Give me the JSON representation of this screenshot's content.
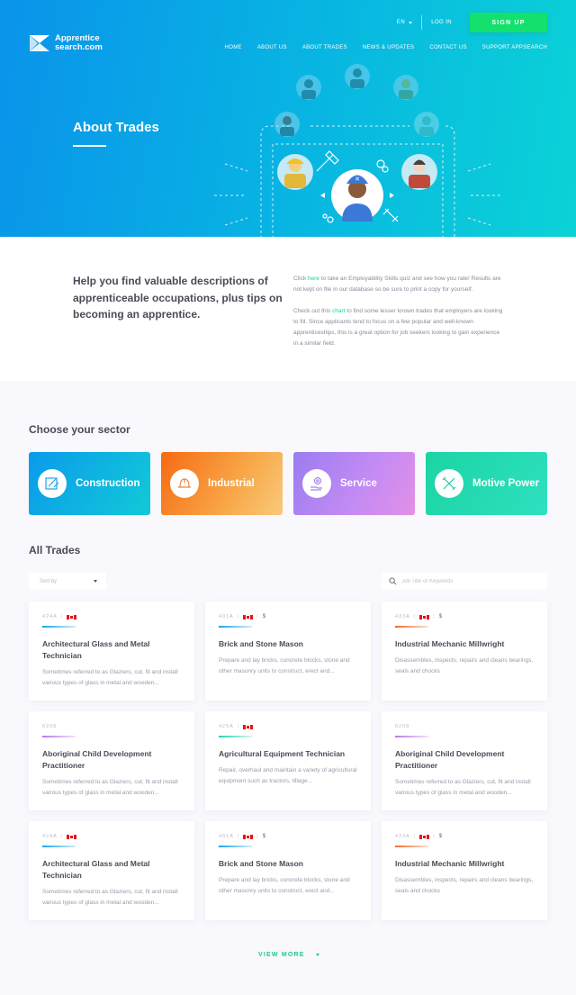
{
  "header": {
    "logo_line1": "Apprentice",
    "logo_line2": "search.com",
    "language": "EN",
    "login_label": "LOG IN",
    "signup_label": "SIGN UP",
    "nav": [
      "HOME",
      "ABOUT US",
      "ABOUT TRADES",
      "NEWS & UPDATES",
      "CONTACT US",
      "SUPPORT APPSEARCH"
    ]
  },
  "hero": {
    "title": "About Trades"
  },
  "intro": {
    "lead": "Help you find valuable descriptions of apprenticeable occupations, plus tips on becoming an apprentice.",
    "p1_before": "Click ",
    "p1_link": "here",
    "p1_after": " to take an Employability Skills quiz and see how you rate! Results are not kept on file in our database so be sure to print a copy for yourself.",
    "p2_before": "Check out this ",
    "p2_link": "chart",
    "p2_after": " to find some lesser known trades that employers are looking to fill. Since applicants tend to focus on a few popular and well-known apprenticeships, this is a great option for job seekers looking to gain experience in a similar field."
  },
  "sectors": {
    "title": "Choose your sector",
    "items": [
      {
        "label": "Construction",
        "icon": "blueprint-icon"
      },
      {
        "label": "Industrial",
        "icon": "hard-hat-icon"
      },
      {
        "label": "Service",
        "icon": "hand-gear-icon"
      },
      {
        "label": "Motive Power",
        "icon": "wrench-screwdriver-icon"
      }
    ]
  },
  "trades": {
    "title": "All Trades",
    "sort_label": "Sort by",
    "search_placeholder": "Job Title or Keywords",
    "view_more": "VIEW MORE",
    "cards": [
      {
        "code": "424A",
        "flag": true,
        "dollar": false,
        "accent": "#1aa6e8",
        "title": "Architectural Glass and Metal Technician",
        "desc": "Sometimes referred to as Glaziers, cut, fit and install various types of glass in metal and wooden..."
      },
      {
        "code": "401A",
        "flag": true,
        "dollar": true,
        "accent": "#1aa6e8",
        "title": "Brick and Stone Mason",
        "desc": "Prepare and lay bricks, concrete blocks, stone and other masonry units to construct, erect and..."
      },
      {
        "code": "433A",
        "flag": true,
        "dollar": true,
        "accent": "#f26a2b",
        "title": "Industrial Mechanic Millwright",
        "desc": "Disassembles, inspects, repairs and cleans bearings, seals and chocks"
      },
      {
        "code": "6208",
        "flag": false,
        "dollar": false,
        "accent": "#b678ee",
        "title": "Aboriginal Child Development Practitioner",
        "desc": "Sometimes referred to as Glaziers, cut, fit and install various types of glass in metal and wooden..."
      },
      {
        "code": "425A",
        "flag": true,
        "dollar": false,
        "accent": "#24d3b5",
        "title": "Agricultural Equipment Technician",
        "desc": "Repair, overhaul and maintain a variety of agricultural equipment such as tractors, tillage..."
      },
      {
        "code": "6208",
        "flag": false,
        "dollar": false,
        "accent": "#b678ee",
        "title": "Aboriginal Child Development Practitioner",
        "desc": "Sometimes referred to as Glaziers, cut, fit and install various types of glass in metal and wooden..."
      },
      {
        "code": "424A",
        "flag": true,
        "dollar": false,
        "accent": "#1aa6e8",
        "title": "Architectural Glass and Metal Technician",
        "desc": "Sometimes referred to as Glaziers, cut, fit and install various types of glass in metal and wooden..."
      },
      {
        "code": "401A",
        "flag": true,
        "dollar": true,
        "accent": "#1aa6e8",
        "title": "Brick and Stone Mason",
        "desc": "Prepare and lay bricks, concrete blocks, stone and other masonry units to construct, erect and..."
      },
      {
        "code": "433A",
        "flag": true,
        "dollar": true,
        "accent": "#f26a2b",
        "title": "Industrial Mechanic Millwright",
        "desc": "Disassembles, inspects, repairs and cleans bearings, seals and chocks"
      }
    ],
    "dollar_symbol": "$"
  },
  "colors": {
    "signup": "#13e06d",
    "link": "#1ed49a",
    "view_more": "#22c98f"
  }
}
